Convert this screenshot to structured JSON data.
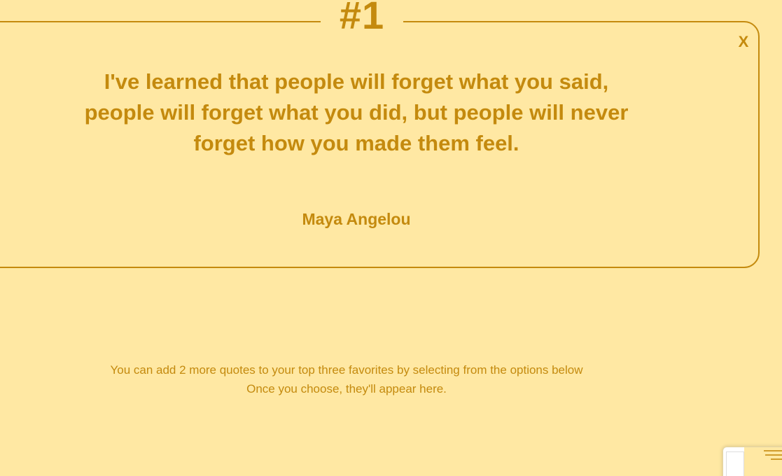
{
  "quote_card": {
    "rank": "#1",
    "close_label": "X",
    "quote": "I've learned that people will forget what you said, people will forget what you did, but people will never forget how you made them feel.",
    "author": "Maya Angelou"
  },
  "info": {
    "line1": "You can add 2 more quotes to your top three favorites by selecting from the options below",
    "line2": "Once you choose, they'll appear here."
  },
  "colors": {
    "background": "#ffe8a3",
    "accent": "#c48a0e"
  }
}
